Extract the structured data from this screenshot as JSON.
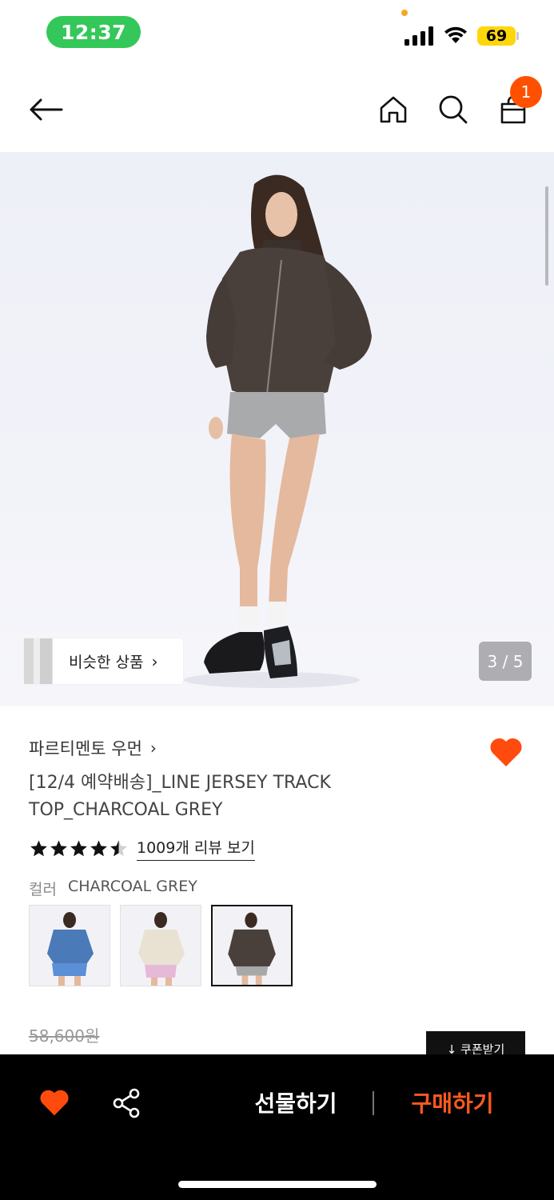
{
  "status_bar": {
    "time": "12:37",
    "battery": "69"
  },
  "nav": {
    "cart_count": "1"
  },
  "hero": {
    "similar_label": "비슷한 상품",
    "chevron": "›",
    "page_counter": "3 / 5"
  },
  "product": {
    "brand": "파르티멘토 우먼",
    "brand_chevron": "›",
    "title": "[12/4 예약배송]_LINE JERSEY TRACK TOP_CHARCOAL GREY",
    "rating": 4.5,
    "reviews_link": "1009개 리뷰 보기",
    "color_label": "컬러",
    "color_value": "CHARCOAL GREY",
    "swatches": [
      {
        "name": "blue",
        "jacket_color": "#4a7ab8",
        "bottom_color": "#5b8fd6",
        "selected": false
      },
      {
        "name": "cream",
        "jacket_color": "#e9e2d2",
        "bottom_color": "#e7b9d9",
        "selected": false
      },
      {
        "name": "charcoal",
        "jacket_color": "#4a403b",
        "bottom_color": "#a8a8a8",
        "selected": true
      }
    ],
    "original_price": "58,600원",
    "coupon_label": "↓ 쿠폰받기"
  },
  "bottom_bar": {
    "gift_label": "선물하기",
    "buy_label": "구매하기"
  },
  "colors": {
    "accent": "#ff5000",
    "heart": "#ff4b0d",
    "buy": "#ff5a1f",
    "status_pill": "#34c759",
    "battery": "#ffd60a"
  },
  "icons": [
    "back-arrow-icon",
    "home-icon",
    "search-icon",
    "shopping-bag-icon",
    "heart-icon",
    "share-icon",
    "star-icon",
    "chevron-right-icon"
  ]
}
